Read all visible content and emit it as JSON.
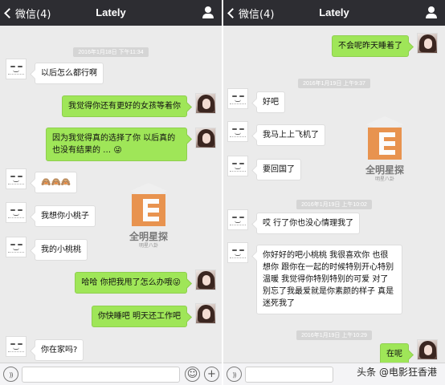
{
  "left": {
    "nav": {
      "back_label": "微信(4)",
      "title": "Lately"
    },
    "timestamps": [
      "2016年1月18日 下午11:34"
    ],
    "messages": [
      {
        "side": "in",
        "text": "以后怎么都行啊"
      },
      {
        "side": "out",
        "text": "我觉得你还有更好的女孩等着你"
      },
      {
        "side": "out",
        "text": "因为我觉得真的选择了你 以后真的也没有结果的 … 😜"
      },
      {
        "side": "in",
        "text": "🙈🙈🙈"
      },
      {
        "side": "in",
        "text": "我想你小桃子"
      },
      {
        "side": "in",
        "text": "我的小桃桃"
      },
      {
        "side": "out",
        "text": "哈哈 你把我甩了怎么办哦😜"
      },
      {
        "side": "out",
        "text": "你快睡吧 明天还工作吧"
      },
      {
        "side": "in",
        "text": "你在家吗?"
      }
    ],
    "watermark": {
      "title": "全明星探",
      "subtitle": "明星八卦"
    }
  },
  "right": {
    "nav": {
      "back_label": "微信(4)",
      "title": "Lately"
    },
    "timestamps": [
      "2016年1月19日 上午9:37",
      "2016年1月19日 上午10:02",
      "2016年1月19日 上午10:29"
    ],
    "messages": [
      {
        "side": "out",
        "text": "不会呢昨天睡着了"
      },
      {
        "side": "in",
        "text": "好吧"
      },
      {
        "side": "in",
        "text": "我马上上飞机了"
      },
      {
        "side": "in",
        "text": "要回国了"
      },
      {
        "side": "in",
        "text": "哎 行了你也没心情理我了"
      },
      {
        "side": "in",
        "text": "你好好的吧小桃桃 我很喜欢你 也很想你 跟你在一起的时候特别开心特别温暖 我觉得你特别特别的可爱 对了 别忘了我最爱就是你素颜的样子 真是迷死我了"
      },
      {
        "side": "out",
        "text": "在呢"
      }
    ],
    "watermark": {
      "title": "全明星探",
      "subtitle": "明星八卦"
    }
  },
  "input_bar": {
    "emoji_glyph": "☺",
    "plus_glyph": "+"
  },
  "credit": "头条 @电影狂香港"
}
